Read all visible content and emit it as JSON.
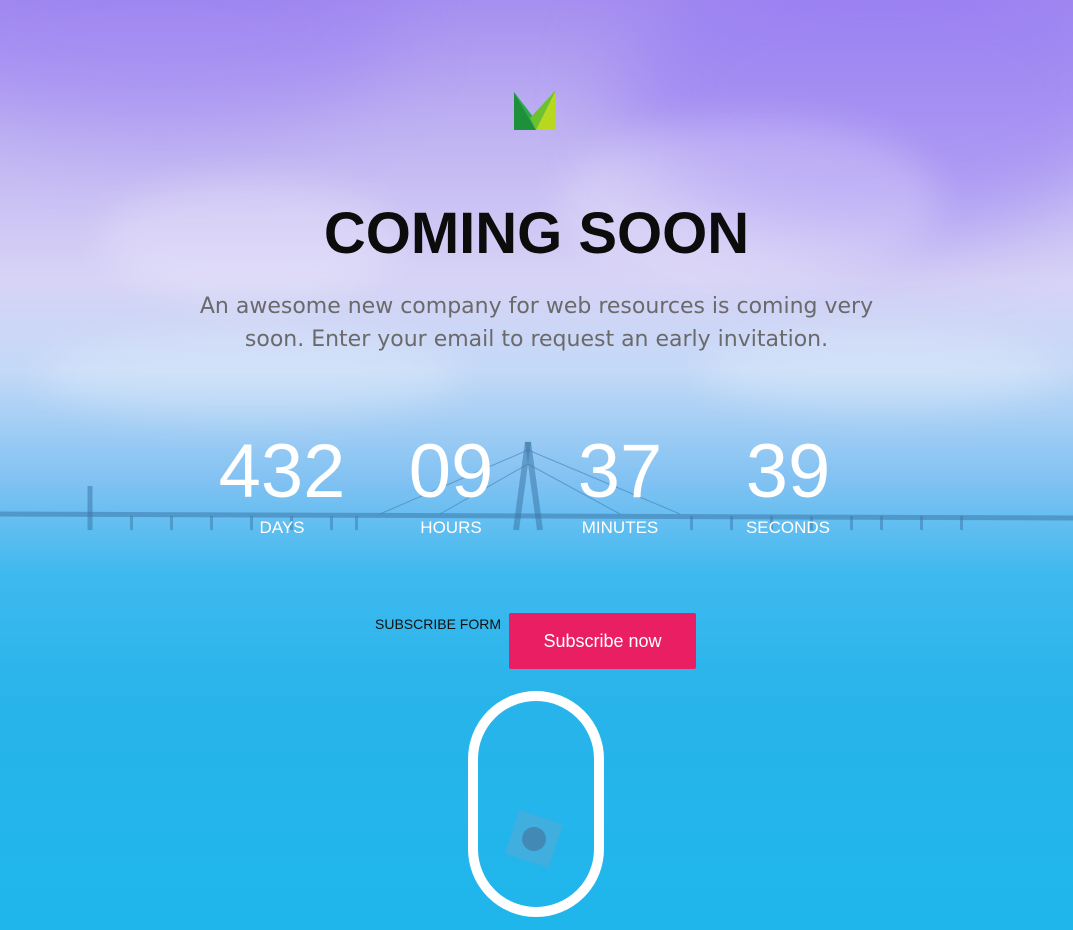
{
  "hero": {
    "title": "COMING SOON",
    "tagline": "An awesome new company for web resources is coming very soon. Enter your email to request an early invitation.",
    "logo_icon": "m-logo-icon",
    "title_color": "#0c0c0c"
  },
  "countdown": [
    {
      "value": "432",
      "label": "DAYS"
    },
    {
      "value": "09",
      "label": "HOURS"
    },
    {
      "value": "37",
      "label": "MINUTES"
    },
    {
      "value": "39",
      "label": "SECONDS"
    }
  ],
  "subscribe": {
    "label": "SUBSCRIBE FORM",
    "button_label": "Subscribe now",
    "button_color": "#e91e63"
  },
  "scroll_indicator": {
    "icon": "scroll-mouse-icon"
  }
}
